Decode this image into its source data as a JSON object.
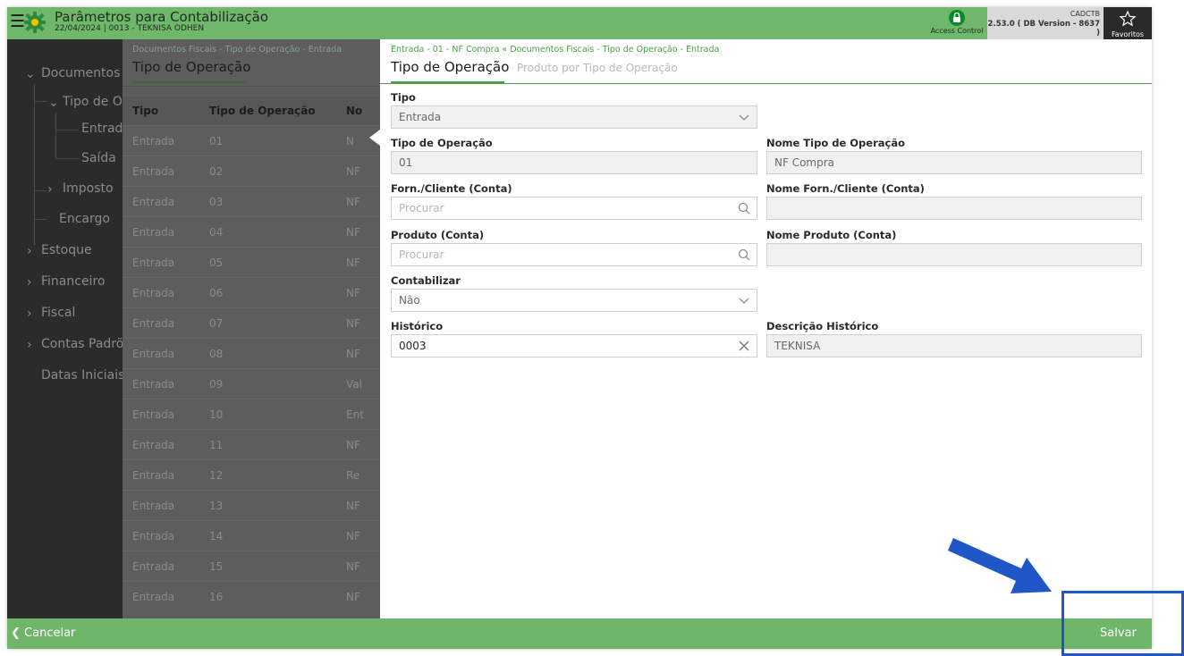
{
  "header": {
    "title": "Parâmetros para Contabilização",
    "subtitle": "22/04/2024 | 0013 - TEKNISA ODHEN",
    "access_control": "Access Control",
    "version_code": "CADCTB",
    "version_text": "2.53.0 ( DB Version - 8637 )",
    "favorites": "Favoritos"
  },
  "sidebar": {
    "items": [
      {
        "label": "Documentos"
      },
      {
        "label": "Tipo de O"
      },
      {
        "label": "Entrad"
      },
      {
        "label": "Saída"
      },
      {
        "label": "Imposto"
      },
      {
        "label": "Encargo"
      },
      {
        "label": "Estoque"
      },
      {
        "label": "Financeiro"
      },
      {
        "label": "Fiscal"
      },
      {
        "label": "Contas Padrõ"
      },
      {
        "label": "Datas Iniciais"
      }
    ]
  },
  "list": {
    "breadcrumb": "Documentos Fiscais - Tipo de Operação - Entrada",
    "title": "Tipo de Operação",
    "columns": [
      "Tipo",
      "Tipo de Operação",
      "No"
    ],
    "rows": [
      {
        "tipo": "Entrada",
        "codigo": "01",
        "nome": "N"
      },
      {
        "tipo": "Entrada",
        "codigo": "02",
        "nome": "NF"
      },
      {
        "tipo": "Entrada",
        "codigo": "03",
        "nome": "NF"
      },
      {
        "tipo": "Entrada",
        "codigo": "04",
        "nome": "NF"
      },
      {
        "tipo": "Entrada",
        "codigo": "05",
        "nome": "NF"
      },
      {
        "tipo": "Entrada",
        "codigo": "06",
        "nome": "NF"
      },
      {
        "tipo": "Entrada",
        "codigo": "07",
        "nome": "NF"
      },
      {
        "tipo": "Entrada",
        "codigo": "08",
        "nome": "NF"
      },
      {
        "tipo": "Entrada",
        "codigo": "09",
        "nome": "Val"
      },
      {
        "tipo": "Entrada",
        "codigo": "10",
        "nome": "Ent"
      },
      {
        "tipo": "Entrada",
        "codigo": "11",
        "nome": "NF"
      },
      {
        "tipo": "Entrada",
        "codigo": "12",
        "nome": "Re"
      },
      {
        "tipo": "Entrada",
        "codigo": "13",
        "nome": "NF"
      },
      {
        "tipo": "Entrada",
        "codigo": "14",
        "nome": "NF"
      },
      {
        "tipo": "Entrada",
        "codigo": "15",
        "nome": "NF"
      },
      {
        "tipo": "Entrada",
        "codigo": "16",
        "nome": "NF"
      }
    ]
  },
  "form": {
    "breadcrumb": "Entrada - 01 - NF Compra « Documentos Fiscais - Tipo de Operação - Entrada",
    "tab_active": "Tipo de Operação",
    "tab_inactive": "Produto por Tipo de Operação",
    "fields": {
      "tipo": {
        "label": "Tipo",
        "value": "Entrada"
      },
      "tipo_operacao": {
        "label": "Tipo de Operação",
        "value": "01"
      },
      "nome_tipo_operacao": {
        "label": "Nome Tipo de Operação",
        "value": "NF Compra"
      },
      "forn_cliente": {
        "label": "Forn./Cliente (Conta)",
        "placeholder": "Procurar"
      },
      "nome_forn_cliente": {
        "label": "Nome Forn./Cliente (Conta)",
        "value": ""
      },
      "produto": {
        "label": "Produto (Conta)",
        "placeholder": "Procurar"
      },
      "nome_produto": {
        "label": "Nome Produto (Conta)",
        "value": ""
      },
      "contabilizar": {
        "label": "Contabilizar",
        "value": "Não"
      },
      "historico": {
        "label": "Histórico",
        "value": "0003"
      },
      "descricao_historico": {
        "label": "Descrição Histórico",
        "value": "TEKNISA"
      }
    }
  },
  "footer": {
    "cancel": "Cancelar",
    "save": "Salvar"
  },
  "icons": {
    "menu": "hamburger-icon",
    "app": "gear-icon",
    "lock": "lock-icon",
    "favorites": "star-icon",
    "dropdown": "chevron-down-icon",
    "search": "search-icon",
    "clear": "close-icon",
    "cancel": "chevron-left-icon"
  },
  "colors": {
    "brand_green": "#6fb76a",
    "accent_green": "#4aa045",
    "annotation_blue": "#1f57c8"
  }
}
